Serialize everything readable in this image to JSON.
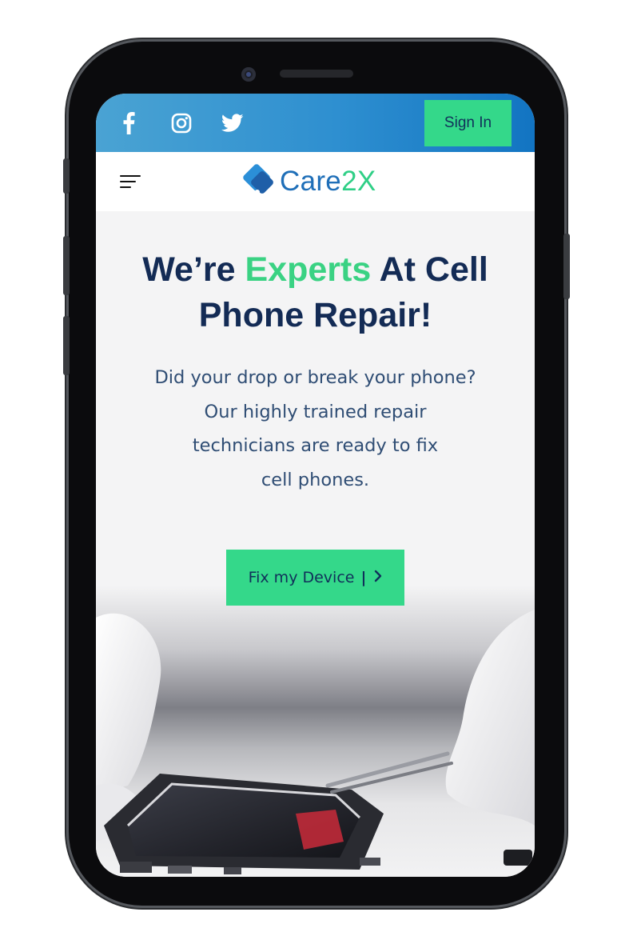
{
  "topbar": {
    "social_icons": [
      "facebook-icon",
      "instagram-icon",
      "twitter-icon"
    ],
    "signin_label": "Sign In"
  },
  "nav": {
    "menu_icon": "hamburger-menu-icon",
    "brand_main": "Care",
    "brand_accent": "2X"
  },
  "hero": {
    "title_part1": "We’re ",
    "title_highlight": "Experts",
    "title_part2": " At Cell",
    "title_line2": "Phone Repair!",
    "subtitle_lines": [
      "Did your drop or break your phone?",
      "Our highly trained repair",
      "technicians are ready to fix",
      "cell phones."
    ],
    "cta_label": "Fix my Device",
    "cta_separator": "|",
    "cta_icon": "chevron-right-icon"
  },
  "colors": {
    "topbar_gradient": [
      "#4aa3d3",
      "#1274c2"
    ],
    "accent_green": "#34d88a",
    "heading_navy": "#132b55",
    "brand_blue": "#1f6fb8"
  }
}
